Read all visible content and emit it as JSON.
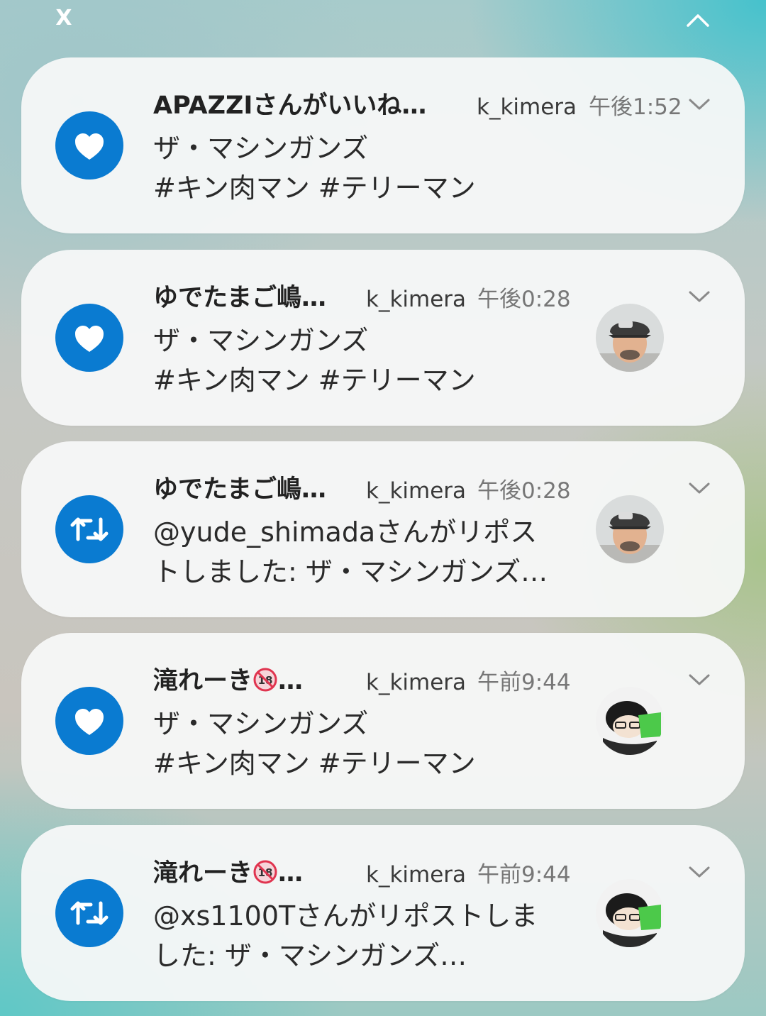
{
  "app": {
    "icon_name": "x-logo",
    "label": "X",
    "collapse_icon": "chevron-up-icon"
  },
  "accent_color": "#0a7bd1",
  "notifications": [
    {
      "type": "like",
      "icon": "heart-icon",
      "sender": "APAZZIさんがいいね…",
      "account": "k_kimera",
      "time": "午後1:52",
      "line1": "ザ・マシンガンズ",
      "line2": "#キン肉マン #テリーマン",
      "avatar": null
    },
    {
      "type": "like",
      "icon": "heart-icon",
      "sender": "ゆでたまご嶋…",
      "account": "k_kimera",
      "time": "午後0:28",
      "line1": "ザ・マシンガンズ",
      "line2": "#キン肉マン #テリーマン",
      "avatar": "man-with-cap-avatar"
    },
    {
      "type": "repost",
      "icon": "repost-icon",
      "sender": "ゆでたまご嶋…",
      "account": "k_kimera",
      "time": "午後0:28",
      "line1": "@yude_shimadaさんがリポス",
      "line2": "トしました: ザ・マシンガンズ…",
      "avatar": "man-with-cap-avatar"
    },
    {
      "type": "like",
      "icon": "heart-icon",
      "sender_prefix": "滝れーき",
      "sender_suffix": "…",
      "sender_emoji": "no-under-18-emoji",
      "account": "k_kimera",
      "time": "午前9:44",
      "line1": "ザ・マシンガンズ",
      "line2": "#キン肉マン #テリーマン",
      "avatar": "cartoon-character-avatar"
    },
    {
      "type": "repost",
      "icon": "repost-icon",
      "sender_prefix": "滝れーき",
      "sender_suffix": "…",
      "sender_emoji": "no-under-18-emoji",
      "account": "k_kimera",
      "time": "午前9:44",
      "line1": "@xs1100Tさんがリポストしま",
      "line2": "した: ザ・マシンガンズ…",
      "avatar": "cartoon-character-avatar"
    }
  ]
}
